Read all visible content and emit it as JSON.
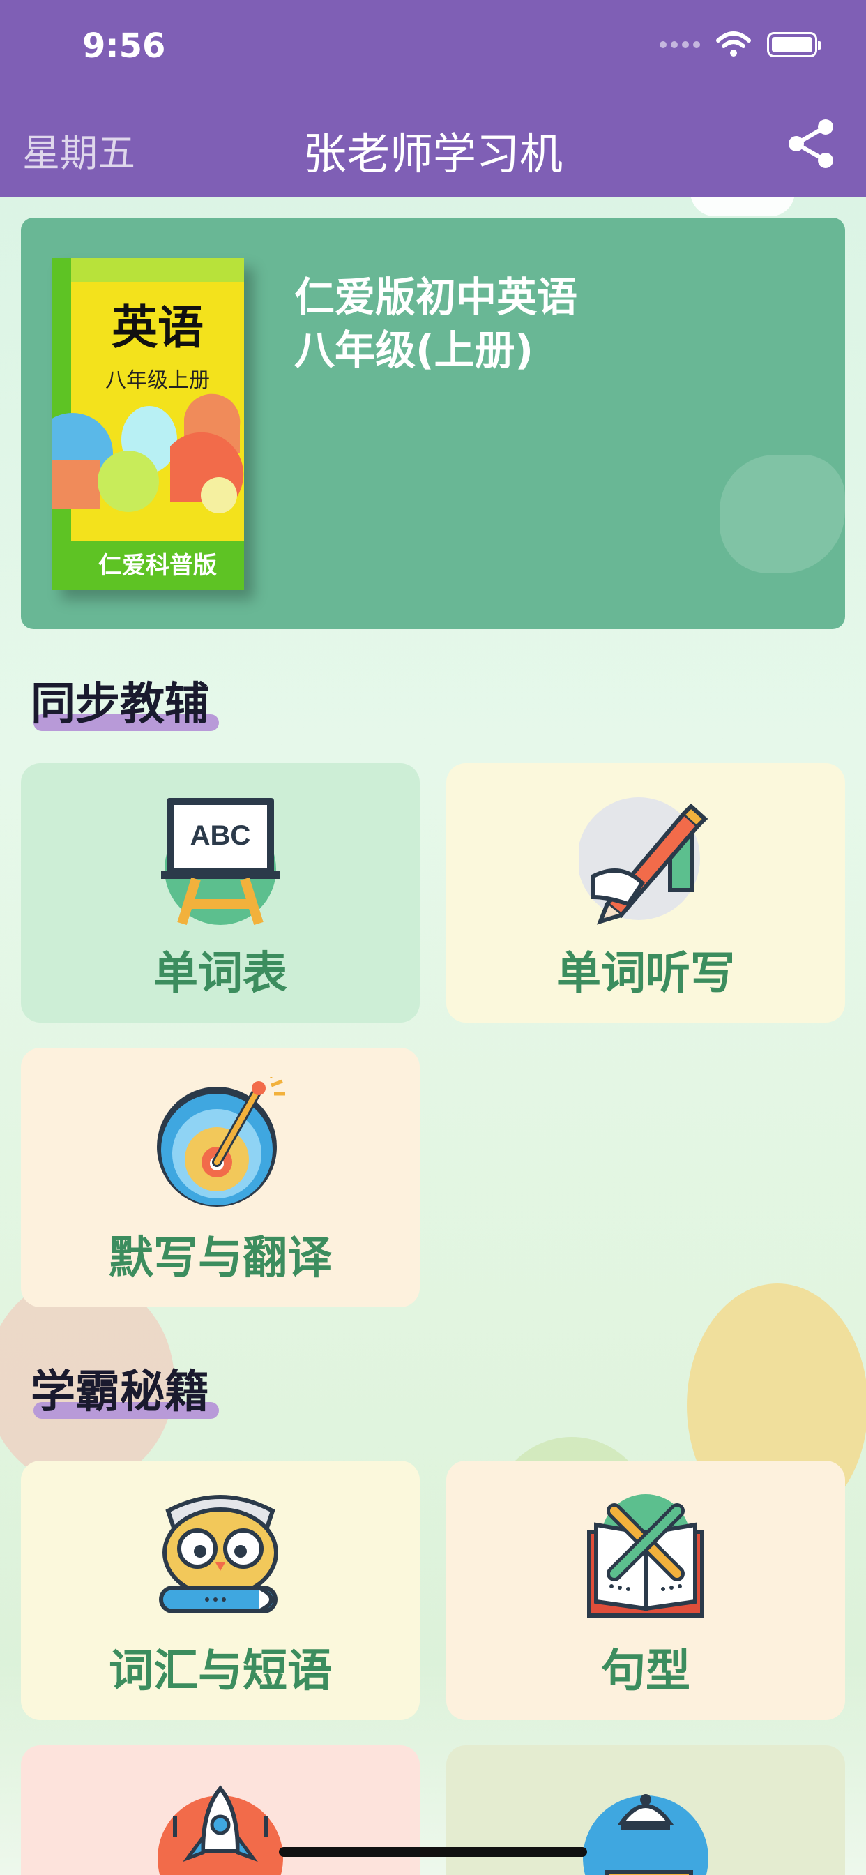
{
  "status": {
    "time": "9:56"
  },
  "nav": {
    "day": "星期五",
    "title": "张老师学习机",
    "share_icon": "share-icon"
  },
  "book": {
    "cover_title": "英语",
    "cover_subtitle": "八年级上册",
    "cover_publisher": "仁爱科普版",
    "name": "仁爱版初中英语\n八年级(上册)"
  },
  "sections": {
    "sync": "同步教辅",
    "secrets": "学霸秘籍"
  },
  "tiles": {
    "word_list": "单词表",
    "word_dictation": "单词听写",
    "dictation_translation": "默写与翻译",
    "vocab_phrases": "词汇与短语",
    "sentence_patterns": "句型"
  },
  "colors": {
    "nav": "#7f5fb5",
    "book_card": "#69b795",
    "tile_green": "#cdeed6",
    "tile_cream": "#fbf8dc",
    "tile_peach": "#fdf1dd",
    "tile_pink": "#fde3dc",
    "tile_olive": "#e4ecd0",
    "label": "#3c8d5e"
  }
}
